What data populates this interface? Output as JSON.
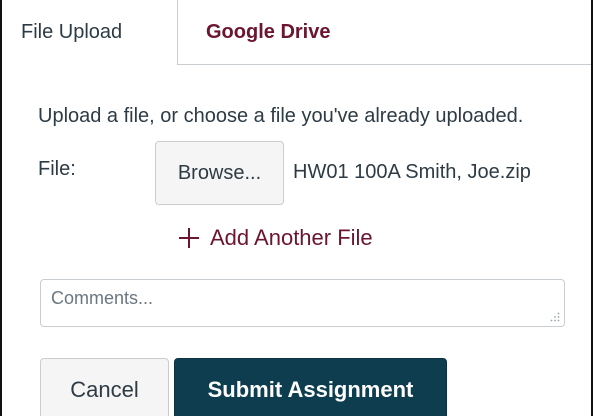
{
  "tabs": [
    {
      "label": "File Upload",
      "active": true
    },
    {
      "label": "Google Drive",
      "active": false
    }
  ],
  "upload": {
    "prompt": "Upload a file, or choose a file you've already uploaded.",
    "file_label": "File:",
    "browse_label": "Browse...",
    "file_name": "HW01 100A Smith, Joe.zip",
    "add_file_label": "Add Another File",
    "add_file_icon": "plus-icon"
  },
  "comments": {
    "placeholder": "Comments...",
    "value": ""
  },
  "actions": {
    "cancel_label": "Cancel",
    "submit_label": "Submit Assignment"
  },
  "colors": {
    "link": "#6b1530",
    "submit_bg": "#0e3d4f",
    "text": "#2d3b45",
    "button_bg": "#f5f5f5",
    "border": "#c7cdd1"
  }
}
